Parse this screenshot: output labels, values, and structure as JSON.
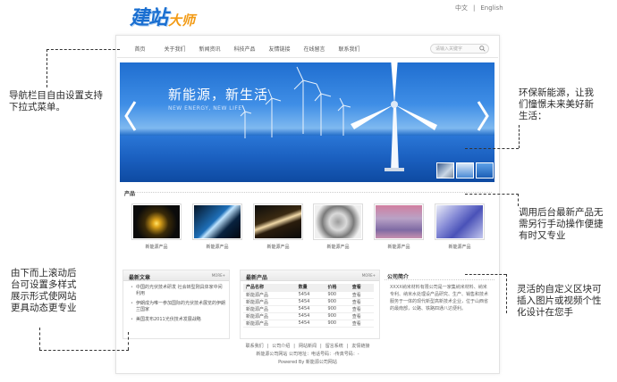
{
  "logo": {
    "part1": "建站",
    "part2": "大师"
  },
  "lang": {
    "zh": "中文",
    "sep": "|",
    "en": "English"
  },
  "nav": {
    "items": [
      "首页",
      "关于我们",
      "新闻资讯",
      "科技产品",
      "友情链接",
      "在线留言",
      "联系我们"
    ],
    "search_placeholder": "请输入关键字"
  },
  "banner": {
    "title": "新能源，新生活",
    "subtitle": "NEW ENERGY, NEW LIFE"
  },
  "products": {
    "title": "产品",
    "items": [
      "新能源产品",
      "新能源产品",
      "新能源产品",
      "新能源产品",
      "新能源产品",
      "新能源产品"
    ]
  },
  "news": {
    "title": "最新文章",
    "more": "MORE+",
    "items": [
      "中国的光伏技术研发 社会转型刚具体家中间利用",
      "伊朗成为唯一参加国际的光伏技术展览的伊朗兰国家",
      "美国发布2011光伏技术发展战略"
    ]
  },
  "latest_products": {
    "title": "最新产品",
    "more": "MORE+",
    "headers": [
      "产品名称",
      "数量",
      "价格",
      "查看"
    ],
    "rows": [
      [
        "新能源产品",
        "5454",
        "900",
        "查看"
      ],
      [
        "新能源产品",
        "5454",
        "900",
        "查看"
      ],
      [
        "新能源产品",
        "5454",
        "900",
        "查看"
      ],
      [
        "新能源产品",
        "5454",
        "900",
        "查看"
      ],
      [
        "新能源产品",
        "5454",
        "900",
        "查看"
      ]
    ]
  },
  "company": {
    "title": "公司简介",
    "text": "XXXX纳米材料有限公司是一家集纳米材料、纳米专利、纳米水处理设产品研究、生产、销售和技术服务于一体的现代新型高新技术企业，位于山西省的最南部，公路、铁路四通八达便利。"
  },
  "footer": {
    "links": [
      "联系我们",
      "|",
      "公司介绍",
      "|",
      "网站新闻",
      "|",
      "留言系统",
      "|",
      "友情链接"
    ],
    "line2": "新能源公司网站 公司地址：电话号码：-传真号码：-",
    "line3": "Powered By 新能源公司网站"
  },
  "annotations": {
    "nav": "导航栏目自由设置支持下拉式菜单。",
    "banner": "环保新能源，让我们憧憬未来美好新生活：",
    "products": "调用后台最新产品无需另行手动操作便捷有时又专业",
    "scroll": "由下而上滚动后台可设置多样式展示形式使网站更具动态更专业",
    "custom": "灵活的自定义区块可插入图片或视频个性化设计在您手"
  },
  "colors": {
    "accent": "#1a6fd1",
    "logo_orange": "#f29a14",
    "banner_blue": "#1f6ed0"
  }
}
